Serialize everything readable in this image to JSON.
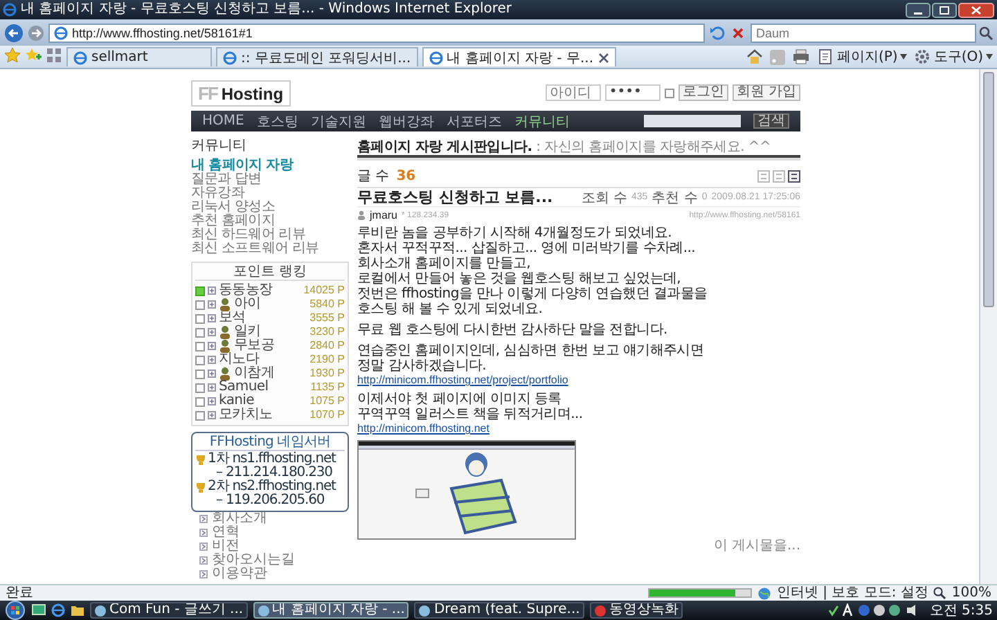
{
  "window": {
    "title": "내 홈페이지 자랑 - 무료호스팅 신청하고 보름... - Windows Internet Explorer"
  },
  "address_bar": {
    "url": "http://www.ffhosting.net/58161#1"
  },
  "search_box": {
    "placeholder": "Daum"
  },
  "tabs": [
    {
      "label": "sellmart",
      "selected": false
    },
    {
      "label": ":: 무료도메인 포워딩서비...",
      "selected": false
    },
    {
      "label": "내 홈페이지 자랑 - 무...",
      "selected": true
    }
  ],
  "command_bar": {
    "items": [
      "페이지(P)",
      "도구(O)"
    ]
  },
  "site": {
    "logo": {
      "prefix": "FF",
      "name": "Hosting"
    },
    "login": {
      "id_placeholder": "아이디",
      "password": "••••",
      "remember": false,
      "buttons": [
        "로그인",
        "회원 가입"
      ]
    },
    "nav": [
      {
        "label": "HOME",
        "selected": false
      },
      {
        "label": "호스팅",
        "selected": false
      },
      {
        "label": "기술지원",
        "selected": false
      },
      {
        "label": "웹버강좌",
        "selected": false
      },
      {
        "label": "서포터즈",
        "selected": false
      },
      {
        "label": "커뮤니티",
        "selected": true
      }
    ],
    "search_button": "검색",
    "sidebar": {
      "heading": "커뮤니티",
      "menu": [
        {
          "label": "내 홈페이지 자랑",
          "selected": true
        },
        {
          "label": "질문과 답변",
          "selected": false
        },
        {
          "label": "자유강좌",
          "selected": false
        },
        {
          "label": "리눅서 양성소",
          "selected": false
        },
        {
          "label": "추천 홈페이지",
          "selected": false
        },
        {
          "label": "최신 하드웨어 리뷰",
          "selected": false
        },
        {
          "label": "최신 소프트웨어 리뷰",
          "selected": false
        }
      ],
      "ranking": {
        "title": "포인트 랭킹",
        "entries": [
          {
            "name": "동동농장",
            "points": "14025 P",
            "checked": true,
            "avatar": false
          },
          {
            "name": "아이",
            "points": "5840 P",
            "checked": false,
            "avatar": true
          },
          {
            "name": "보석",
            "points": "3555 P",
            "checked": false,
            "avatar": false
          },
          {
            "name": "일키",
            "points": "3230 P",
            "checked": false,
            "avatar": true
          },
          {
            "name": "무보공",
            "points": "2840 P",
            "checked": false,
            "avatar": true
          },
          {
            "name": "지노다",
            "points": "2190 P",
            "checked": false,
            "avatar": false
          },
          {
            "name": "이참게",
            "points": "1930 P",
            "checked": false,
            "avatar": true
          },
          {
            "name": "Samuel",
            "points": "1135 P",
            "checked": false,
            "avatar": false
          },
          {
            "name": "kanie",
            "points": "1075 P",
            "checked": false,
            "avatar": false
          },
          {
            "name": "모카치노",
            "points": "1070 P",
            "checked": false,
            "avatar": false
          }
        ]
      },
      "nameservers": {
        "title": "FFHosting 네임서버",
        "entries": [
          {
            "label": "1차 ns1.ffhosting.net",
            "ip": "– 211.214.180.230"
          },
          {
            "label": "2차 ns2.ffhosting.net",
            "ip": "– 119.206.205.60"
          }
        ]
      },
      "footer_links": [
        "회사소개",
        "연혁",
        "비전",
        "찾아오시는길",
        "이용약관"
      ]
    },
    "main": {
      "board_title": "**홈페이지 자랑 게시판입니다.** : 자신의 홈페이지를 자랑해주세요. ^^",
      "count_label": "글 수",
      "count": "36",
      "post": {
        "title": "무료호스팅 신청하고 보름...",
        "views_label": "조회 수",
        "views": "435",
        "votes_label": "추천 수",
        "votes": "0",
        "date": "2009.08.21 17:25:06",
        "author": "jmaru",
        "author_ip": "* 128.234.39",
        "permalink": "http://www.ffhosting.net/58161",
        "body": [
          {
            "kind": "text",
            "text": "루비란 놈을 공부하기 시작해 4개월정도가 되었네요.\n혼자서 꾸적꾸적... 삽질하고... 영에 미러박기를 수차례...\n회사소개 홈페이지를 만들고,\n로컬에서 만들어 놓은 것을 웹호스팅 해보고 싶었는데,\n젓번은 ffhosting을 만나 이렇게 다양히 연습했던 결과물을\n호스팅 해 볼 수 있게 되었네요."
          },
          {
            "kind": "text",
            "text": "무료 웹 호스팅에 다시한번 감사하단 말을 전합니다."
          },
          {
            "kind": "text",
            "text": "연습중인 홈페이지인데, 심심하면 한번 보고 얘기해주시면\n정말 감사하겠습니다."
          },
          {
            "kind": "link",
            "text": "http://minicom.ffhosting.net/project/portfolio"
          },
          {
            "kind": "text",
            "text": "이제서야 첫 페이지에 이미지 등록\n꾸역꾸역 일러스트 책을 뒤적거리며..."
          },
          {
            "kind": "link",
            "text": "http://minicom.ffhosting.net"
          },
          {
            "kind": "image"
          }
        ],
        "more_link": "이 게시물을..."
      }
    }
  },
  "status_bar": {
    "text": "완료",
    "level": 0.85,
    "zone": "인터넷 | 보호 모드: 설정",
    "zoom": "100%"
  },
  "taskbar": {
    "items": [
      {
        "label": "Com Fun - 글쓰기 ...",
        "selected": false
      },
      {
        "label": "내 홈페이지 자랑 - ...",
        "selected": true
      },
      {
        "label": "Dream (feat. Supre...",
        "selected": false
      },
      {
        "label": "동영상녹화",
        "selected": false
      }
    ],
    "clock": "오전 5:35"
  }
}
